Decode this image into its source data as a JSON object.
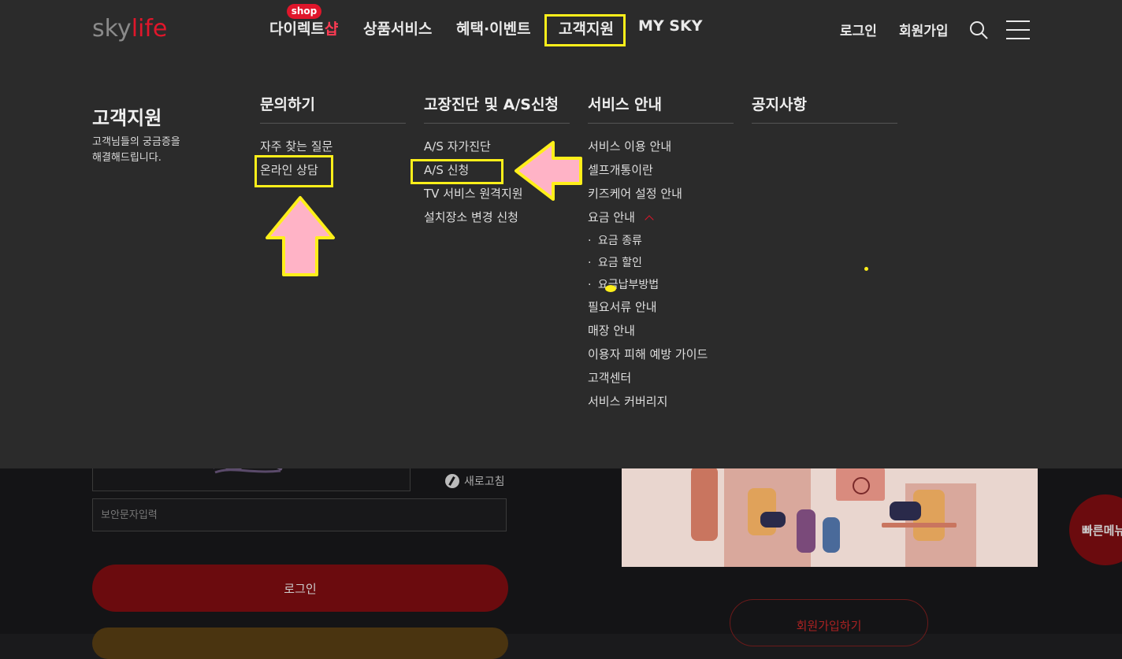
{
  "header": {
    "logo_sky": "sky",
    "logo_life": "life",
    "shop_badge": "shop",
    "nav_direct": "다이렉트",
    "nav_direct_shop": "샵",
    "nav_product": "상품서비스",
    "nav_benefit": "혜택·이벤트",
    "nav_support": "고객지원",
    "nav_mysky": "MY SKY",
    "login": "로그인",
    "join": "회원가입"
  },
  "mega": {
    "title": "고객지원",
    "desc_line1": "고객님들의 궁금증을",
    "desc_line2": "해결해드립니다.",
    "columns": [
      {
        "heading": "문의하기",
        "items": [
          "자주 찾는 질문",
          "온라인 상담"
        ]
      },
      {
        "heading": "고장진단 및 A/S신청",
        "items": [
          "A/S 자가진단",
          "A/S 신청",
          "TV 서비스 원격지원",
          "설치장소 변경 신청"
        ]
      },
      {
        "heading": "서비스 안내",
        "items": [
          "서비스 이용 안내",
          "셀프개통이란",
          "키즈케어 설정 안내",
          "요금 안내"
        ],
        "sub_items": [
          "요금 종류",
          "요금 할인",
          "요금납부방법"
        ],
        "items_after": [
          "필요서류 안내",
          "매장 안내",
          "이용자 피해 예방 가이드",
          "고객센터",
          "서비스 커버리지"
        ]
      },
      {
        "heading": "공지사항",
        "items": []
      }
    ]
  },
  "background": {
    "refresh_label": "새로고침",
    "captcha_placeholder": "보안문자입력",
    "login_button": "로그인",
    "join_button": "회원가입하기",
    "quick_menu": "빠른메뉴"
  },
  "colors": {
    "brand_red": "#e0162b",
    "highlight_yellow": "#ffef1a",
    "arrow_pink": "#ffb3c6"
  }
}
